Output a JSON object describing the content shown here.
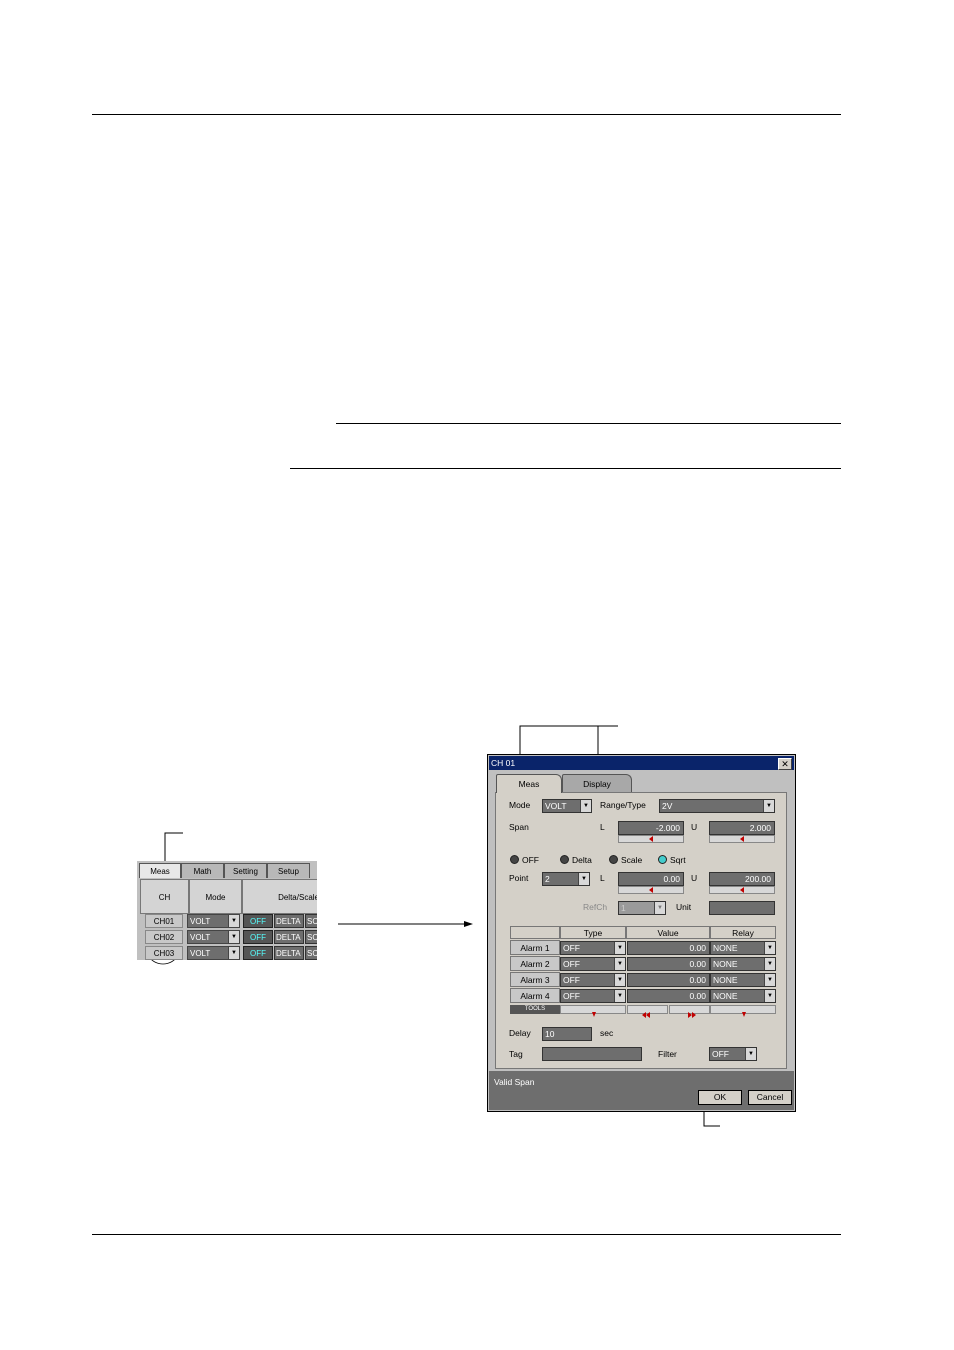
{
  "grid_window": {
    "tabs": [
      "Meas",
      "Math",
      "Setting",
      "Setup"
    ],
    "headers": {
      "ch": "CH",
      "mode": "Mode",
      "delta": "Delta/Scale"
    },
    "rows": [
      {
        "ch": "CH01",
        "mode": "VOLT",
        "off": "OFF",
        "delta": "DELTA",
        "sc": "SC"
      },
      {
        "ch": "CH02",
        "mode": "VOLT",
        "off": "OFF",
        "delta": "DELTA",
        "sc": "SC"
      },
      {
        "ch": "CH03",
        "mode": "VOLT",
        "off": "OFF",
        "delta": "DELTA",
        "sc": "SC"
      }
    ]
  },
  "dialog": {
    "title": "CH 01",
    "close_glyph": "✕",
    "tabs": {
      "meas": "Meas",
      "display": "Display"
    },
    "mode_label": "Mode",
    "mode_value": "VOLT",
    "range_label": "Range/Type",
    "range_value": "2V",
    "span_label": "Span",
    "l_label": "L",
    "u_label": "U",
    "span_l": "-2.000",
    "span_u": "2.000",
    "radio": {
      "off": "OFF",
      "delta": "Delta",
      "scale": "Scale",
      "sqrt": "Sqrt",
      "selected": "sqrt"
    },
    "point_label": "Point",
    "point_value": "2",
    "scale_l": "0.00",
    "scale_u": "200.00",
    "refch_label": "RefCh",
    "refch_value": "1",
    "unit_label": "Unit",
    "unit_value": "",
    "alarm_headers": {
      "type": "Type",
      "value": "Value",
      "relay": "Relay"
    },
    "alarms": [
      {
        "label": "Alarm 1",
        "type": "OFF",
        "value": "0.00",
        "relay": "NONE"
      },
      {
        "label": "Alarm 2",
        "type": "OFF",
        "value": "0.00",
        "relay": "NONE"
      },
      {
        "label": "Alarm 3",
        "type": "OFF",
        "value": "0.00",
        "relay": "NONE"
      },
      {
        "label": "Alarm 4",
        "type": "OFF",
        "value": "0.00",
        "relay": "NONE"
      }
    ],
    "tools_label": "TOOLS",
    "delay_label": "Delay",
    "delay_value": "10",
    "delay_unit": "sec",
    "tag_label": "Tag",
    "tag_value": "",
    "filter_label": "Filter",
    "filter_value": "OFF",
    "status_text": "Valid Span",
    "ok_label": "OK",
    "cancel_label": "Cancel"
  },
  "colors": {
    "titlebar": "#0a246a",
    "field": "#6e6e6e",
    "accent_cyan": "#55ffff",
    "spin_arrow": "#c00000"
  }
}
